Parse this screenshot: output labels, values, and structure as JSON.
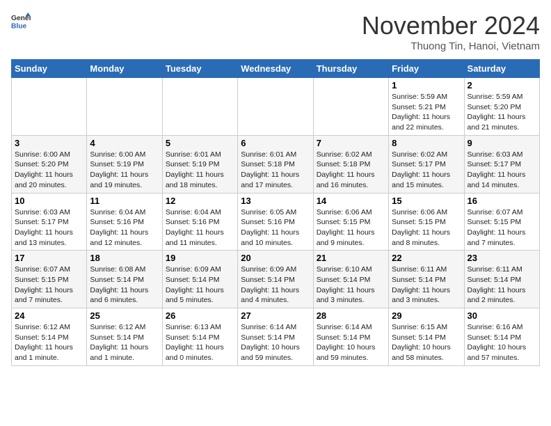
{
  "logo": {
    "general": "General",
    "blue": "Blue"
  },
  "header": {
    "month": "November 2024",
    "location": "Thuong Tin, Hanoi, Vietnam"
  },
  "weekdays": [
    "Sunday",
    "Monday",
    "Tuesday",
    "Wednesday",
    "Thursday",
    "Friday",
    "Saturday"
  ],
  "weeks": [
    [
      {
        "day": "",
        "info": ""
      },
      {
        "day": "",
        "info": ""
      },
      {
        "day": "",
        "info": ""
      },
      {
        "day": "",
        "info": ""
      },
      {
        "day": "",
        "info": ""
      },
      {
        "day": "1",
        "info": "Sunrise: 5:59 AM\nSunset: 5:21 PM\nDaylight: 11 hours and 22 minutes."
      },
      {
        "day": "2",
        "info": "Sunrise: 5:59 AM\nSunset: 5:20 PM\nDaylight: 11 hours and 21 minutes."
      }
    ],
    [
      {
        "day": "3",
        "info": "Sunrise: 6:00 AM\nSunset: 5:20 PM\nDaylight: 11 hours and 20 minutes."
      },
      {
        "day": "4",
        "info": "Sunrise: 6:00 AM\nSunset: 5:19 PM\nDaylight: 11 hours and 19 minutes."
      },
      {
        "day": "5",
        "info": "Sunrise: 6:01 AM\nSunset: 5:19 PM\nDaylight: 11 hours and 18 minutes."
      },
      {
        "day": "6",
        "info": "Sunrise: 6:01 AM\nSunset: 5:18 PM\nDaylight: 11 hours and 17 minutes."
      },
      {
        "day": "7",
        "info": "Sunrise: 6:02 AM\nSunset: 5:18 PM\nDaylight: 11 hours and 16 minutes."
      },
      {
        "day": "8",
        "info": "Sunrise: 6:02 AM\nSunset: 5:17 PM\nDaylight: 11 hours and 15 minutes."
      },
      {
        "day": "9",
        "info": "Sunrise: 6:03 AM\nSunset: 5:17 PM\nDaylight: 11 hours and 14 minutes."
      }
    ],
    [
      {
        "day": "10",
        "info": "Sunrise: 6:03 AM\nSunset: 5:17 PM\nDaylight: 11 hours and 13 minutes."
      },
      {
        "day": "11",
        "info": "Sunrise: 6:04 AM\nSunset: 5:16 PM\nDaylight: 11 hours and 12 minutes."
      },
      {
        "day": "12",
        "info": "Sunrise: 6:04 AM\nSunset: 5:16 PM\nDaylight: 11 hours and 11 minutes."
      },
      {
        "day": "13",
        "info": "Sunrise: 6:05 AM\nSunset: 5:16 PM\nDaylight: 11 hours and 10 minutes."
      },
      {
        "day": "14",
        "info": "Sunrise: 6:06 AM\nSunset: 5:15 PM\nDaylight: 11 hours and 9 minutes."
      },
      {
        "day": "15",
        "info": "Sunrise: 6:06 AM\nSunset: 5:15 PM\nDaylight: 11 hours and 8 minutes."
      },
      {
        "day": "16",
        "info": "Sunrise: 6:07 AM\nSunset: 5:15 PM\nDaylight: 11 hours and 7 minutes."
      }
    ],
    [
      {
        "day": "17",
        "info": "Sunrise: 6:07 AM\nSunset: 5:15 PM\nDaylight: 11 hours and 7 minutes."
      },
      {
        "day": "18",
        "info": "Sunrise: 6:08 AM\nSunset: 5:14 PM\nDaylight: 11 hours and 6 minutes."
      },
      {
        "day": "19",
        "info": "Sunrise: 6:09 AM\nSunset: 5:14 PM\nDaylight: 11 hours and 5 minutes."
      },
      {
        "day": "20",
        "info": "Sunrise: 6:09 AM\nSunset: 5:14 PM\nDaylight: 11 hours and 4 minutes."
      },
      {
        "day": "21",
        "info": "Sunrise: 6:10 AM\nSunset: 5:14 PM\nDaylight: 11 hours and 3 minutes."
      },
      {
        "day": "22",
        "info": "Sunrise: 6:11 AM\nSunset: 5:14 PM\nDaylight: 11 hours and 3 minutes."
      },
      {
        "day": "23",
        "info": "Sunrise: 6:11 AM\nSunset: 5:14 PM\nDaylight: 11 hours and 2 minutes."
      }
    ],
    [
      {
        "day": "24",
        "info": "Sunrise: 6:12 AM\nSunset: 5:14 PM\nDaylight: 11 hours and 1 minute."
      },
      {
        "day": "25",
        "info": "Sunrise: 6:12 AM\nSunset: 5:14 PM\nDaylight: 11 hours and 1 minute."
      },
      {
        "day": "26",
        "info": "Sunrise: 6:13 AM\nSunset: 5:14 PM\nDaylight: 11 hours and 0 minutes."
      },
      {
        "day": "27",
        "info": "Sunrise: 6:14 AM\nSunset: 5:14 PM\nDaylight: 10 hours and 59 minutes."
      },
      {
        "day": "28",
        "info": "Sunrise: 6:14 AM\nSunset: 5:14 PM\nDaylight: 10 hours and 59 minutes."
      },
      {
        "day": "29",
        "info": "Sunrise: 6:15 AM\nSunset: 5:14 PM\nDaylight: 10 hours and 58 minutes."
      },
      {
        "day": "30",
        "info": "Sunrise: 6:16 AM\nSunset: 5:14 PM\nDaylight: 10 hours and 57 minutes."
      }
    ]
  ]
}
